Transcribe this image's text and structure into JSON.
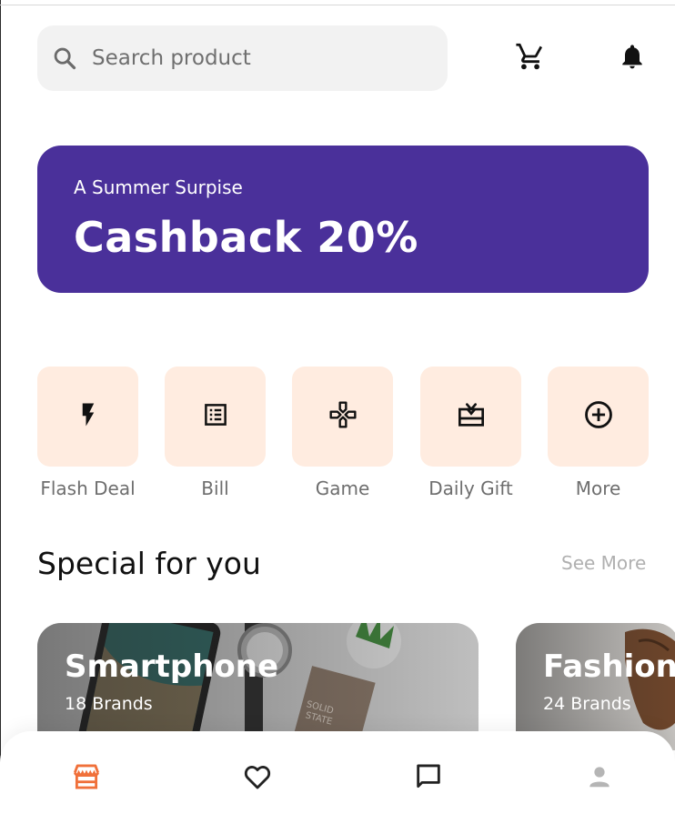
{
  "search": {
    "placeholder": "Search product",
    "icon": "search-icon"
  },
  "header_icons": [
    "cart-icon",
    "bell-icon"
  ],
  "banner": {
    "subtitle": "A Summer Surpise",
    "title": "Cashback 20%",
    "color": "#4a309a"
  },
  "categories": [
    {
      "label": "Flash Deal",
      "icon": "flash-icon"
    },
    {
      "label": "Bill",
      "icon": "bill-icon"
    },
    {
      "label": "Game",
      "icon": "gamepad-icon"
    },
    {
      "label": "Daily Gift",
      "icon": "gift-icon"
    },
    {
      "label": "More",
      "icon": "plus-circle-icon"
    }
  ],
  "special": {
    "title": "Special for you",
    "see_more": "See More",
    "cards": [
      {
        "title": "Smartphone",
        "subtitle": "18 Brands"
      },
      {
        "title": "Fashion",
        "subtitle": "24 Brands"
      }
    ]
  },
  "bottom_nav": {
    "items": [
      "shop-icon",
      "heart-icon",
      "chat-icon",
      "user-icon"
    ],
    "active_color": "#f0703a"
  }
}
